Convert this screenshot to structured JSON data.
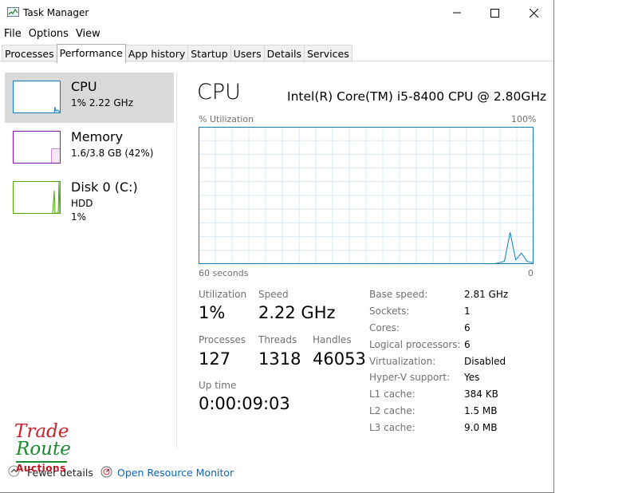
{
  "window": {
    "title": "Task Manager"
  },
  "menu": [
    "File",
    "Options",
    "View"
  ],
  "tabs": [
    "Processes",
    "Performance",
    "App history",
    "Startup",
    "Users",
    "Details",
    "Services"
  ],
  "sidebar": {
    "items": [
      {
        "title": "CPU",
        "sub": "1%  2.22 GHz",
        "sub2": "",
        "color": "#117dbb"
      },
      {
        "title": "Memory",
        "sub": "1.6/3.8 GB (42%)",
        "sub2": "",
        "color": "#8b12ae"
      },
      {
        "title": "Disk 0 (C:)",
        "sub": "HDD",
        "sub2": "1%",
        "color": "#4da60c"
      }
    ]
  },
  "main": {
    "title": "CPU",
    "model": "Intel(R) Core(TM) i5-8400 CPU @ 2.80GHz",
    "graph_label": "% Utilization",
    "graph_max": "100%",
    "time_left": "60 seconds",
    "time_right": "0",
    "graph_color": "#117dbb",
    "utilization_series": [
      0,
      0,
      0,
      0,
      0,
      0,
      0,
      0,
      0,
      0,
      0,
      0,
      0,
      0,
      0,
      0,
      0,
      0,
      0,
      0,
      0,
      0,
      0,
      0,
      0,
      0,
      0,
      0,
      0,
      0,
      0,
      0,
      0,
      0,
      0,
      0,
      0,
      0,
      0,
      0,
      0,
      0,
      0,
      0,
      0,
      0,
      0,
      0,
      0,
      0,
      0,
      0,
      0,
      1,
      2,
      23,
      3,
      8,
      2,
      1
    ]
  },
  "stats": {
    "utilization_label": "Utilization",
    "utilization_value": "1%",
    "speed_label": "Speed",
    "speed_value": "2.22 GHz",
    "processes_label": "Processes",
    "processes_value": "127",
    "threads_label": "Threads",
    "threads_value": "1318",
    "handles_label": "Handles",
    "handles_value": "46053",
    "uptime_label": "Up time",
    "uptime_value": "0:00:09:03"
  },
  "specs": [
    {
      "label": "Base speed:",
      "value": "2.81 GHz"
    },
    {
      "label": "Sockets:",
      "value": "1"
    },
    {
      "label": "Cores:",
      "value": "6"
    },
    {
      "label": "Logical processors:",
      "value": "6"
    },
    {
      "label": "Virtualization:",
      "value": "Disabled"
    },
    {
      "label": "Hyper-V support:",
      "value": "Yes"
    },
    {
      "label": "L1 cache:",
      "value": "384 KB"
    },
    {
      "label": "L2 cache:",
      "value": "1.5 MB"
    },
    {
      "label": "L3 cache:",
      "value": "9.0 MB"
    }
  ],
  "footer": {
    "fewer_details": "Fewer details",
    "open_resource_monitor": "Open Resource Monitor"
  },
  "watermark": {
    "line1": "Trade",
    "line2": "Route",
    "line3": "Auctions"
  }
}
